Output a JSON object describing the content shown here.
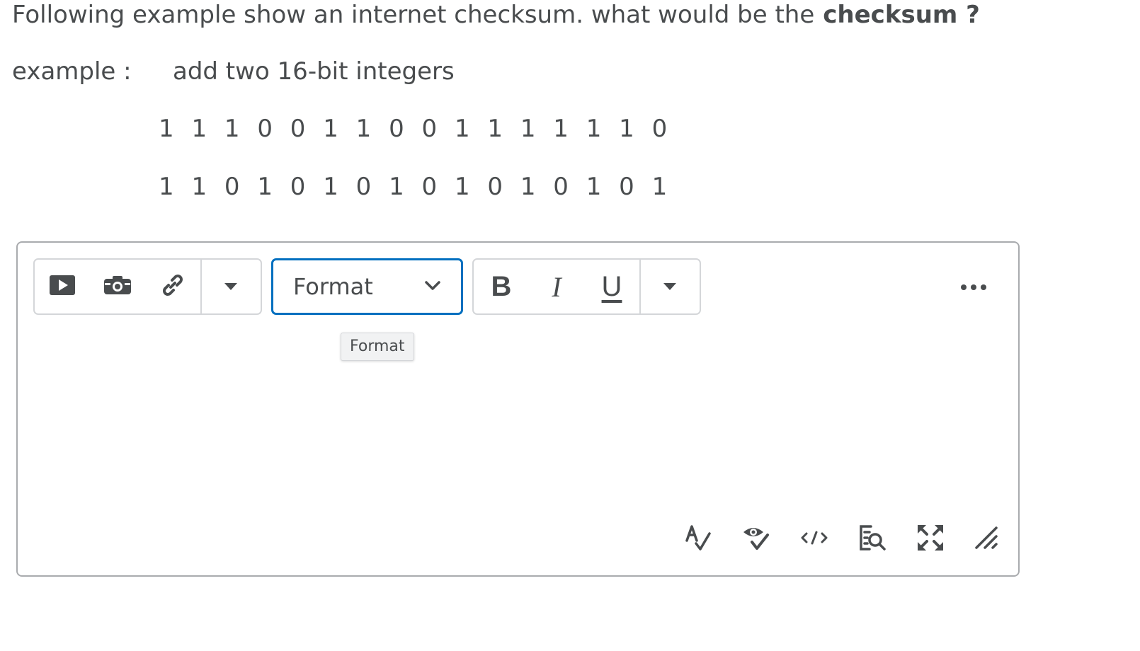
{
  "question": {
    "text": "Following example show an internet checksum. what would be the",
    "bold": "checksum ?"
  },
  "example": {
    "label": "example :",
    "text": "add two 16-bit integers",
    "binary_1": "1 1 1 0 0 1 1 0 0 1 1 1 1 1 1 0",
    "binary_2": "1 1 0 1 0 1 0 1 0 1 0 1 0 1 0 1"
  },
  "toolbar": {
    "group1": [
      "insert-video-icon",
      "insert-image-icon",
      "insert-link-icon",
      "more-insert-caret-icon"
    ],
    "format_label": "Format",
    "format_tooltip": "Format",
    "bold_label": "B",
    "italic_label": "I",
    "underline_label": "U",
    "more_label": "•••"
  },
  "bottom_tools": [
    "spellcheck-icon",
    "accessibility-check-icon",
    "source-code-icon",
    "preview-icon",
    "fullscreen-icon",
    "resize-handle-icon"
  ],
  "colors": {
    "text": "#494c4e",
    "border": "#a9abae",
    "focus": "#006fbf"
  }
}
